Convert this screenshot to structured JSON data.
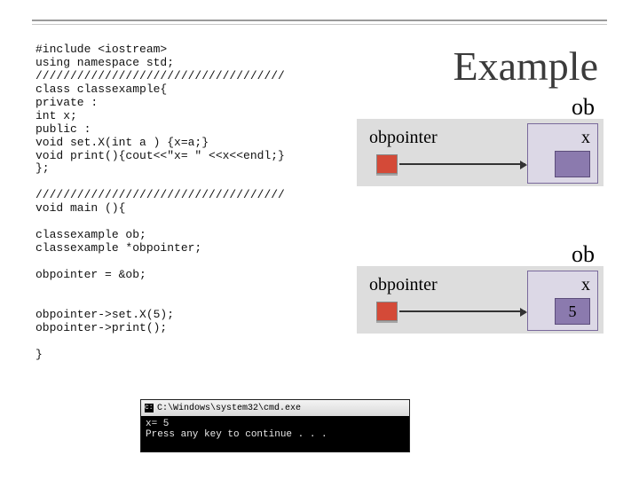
{
  "title": "Example",
  "code": {
    "l1": "#include <iostream>",
    "l2": "using namespace std;",
    "l3": "////////////////////////////////////",
    "l4": "class classexample{",
    "l5": "private :",
    "l6": "int x;",
    "l7": "public :",
    "l8": "void set.X(int a ) {x=a;}",
    "l9": "void print(){cout<<\"x= \" <<x<<endl;}",
    "l10": "};",
    "l11": "",
    "l12": "////////////////////////////////////",
    "l13": "void main (){",
    "l14": "",
    "l15": "classexample ob;",
    "l16": "classexample *obpointer;",
    "l17": "",
    "l18": "obpointer = &ob;",
    "l19": "",
    "l20": "",
    "l21": "obpointer->set.X(5);",
    "l22": "obpointer->print();",
    "l23": "",
    "l24": "}"
  },
  "diagram1": {
    "pointer_label": "obpointer",
    "ob_label": "ob",
    "x_label": "x",
    "x_value": ""
  },
  "diagram2": {
    "pointer_label": "obpointer",
    "ob_label": "ob",
    "x_label": "x",
    "x_value": "5"
  },
  "cmd": {
    "title": "C:\\Windows\\system32\\cmd.exe",
    "line1": "x= 5",
    "line2": "Press any key to continue . . ."
  }
}
